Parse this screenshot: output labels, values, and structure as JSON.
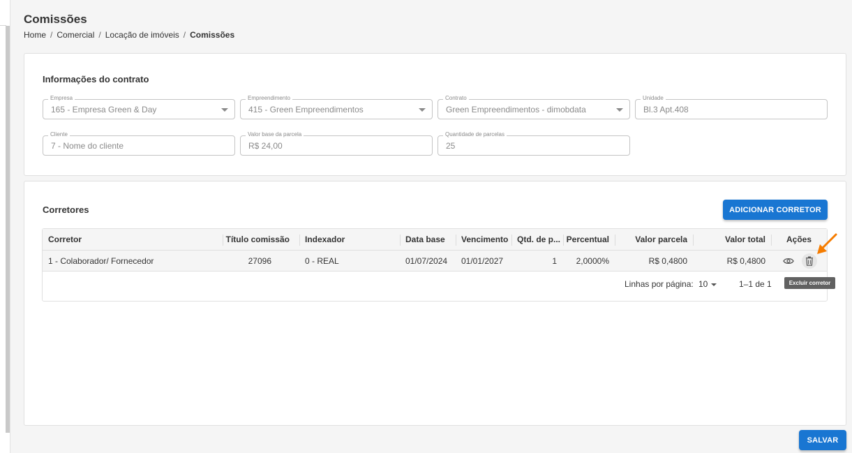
{
  "page": {
    "title": "Comissões",
    "breadcrumb": [
      "Home",
      "Comercial",
      "Locação de imóveis",
      "Comissões"
    ]
  },
  "contract": {
    "title": "Informações do contrato",
    "fields": {
      "empresa": {
        "label": "Empresa",
        "value": "165 - Empresa Green & Day"
      },
      "empreendimento": {
        "label": "Empreendimento",
        "value": "415 - Green Empreendimentos"
      },
      "contrato": {
        "label": "Contrato",
        "value": "Green Empreendimentos - dimobdata"
      },
      "unidade": {
        "label": "Unidade",
        "value": "Bl.3 Apt.408"
      },
      "cliente": {
        "label": "Cliente",
        "value": "7 - Nome do cliente"
      },
      "valor_base": {
        "label": "Valor base da parcela",
        "value": "R$ 24,00"
      },
      "qtd_parcelas": {
        "label": "Quantidade de parcelas",
        "value": "25"
      }
    }
  },
  "corretores": {
    "title": "Corretores",
    "add_button": "Adicionar corretor",
    "columns": {
      "corretor": "Corretor",
      "titulo": "Título comissão",
      "indexador": "Indexador",
      "data_base": "Data base",
      "vencimento": "Vencimento",
      "qtd": "Qtd. de p...",
      "percentual": "Percentual",
      "valor_parcela": "Valor parcela",
      "valor_total": "Valor total",
      "acoes": "Ações"
    },
    "rows": [
      {
        "corretor": "1 - Colaborador/ Fornecedor",
        "titulo": "27096",
        "indexador": "0 - REAL",
        "data_base": "01/07/2024",
        "vencimento": "01/01/2027",
        "qtd": "1",
        "percentual": "2,0000%",
        "valor_parcela": "R$ 0,4800",
        "valor_total": "R$ 0,4800"
      }
    ],
    "pagination": {
      "rows_label": "Linhas por página:",
      "rows_value": "10",
      "range": "1–1 de 1"
    },
    "tooltip": "Excluir corretor"
  },
  "footer": {
    "save_button": "Salvar"
  },
  "colors": {
    "primary": "#1976d2",
    "arrow": "#f57c00"
  },
  "icons": [
    "chevron-down-icon",
    "eye-icon",
    "trash-icon",
    "arrow-pointer-icon"
  ]
}
